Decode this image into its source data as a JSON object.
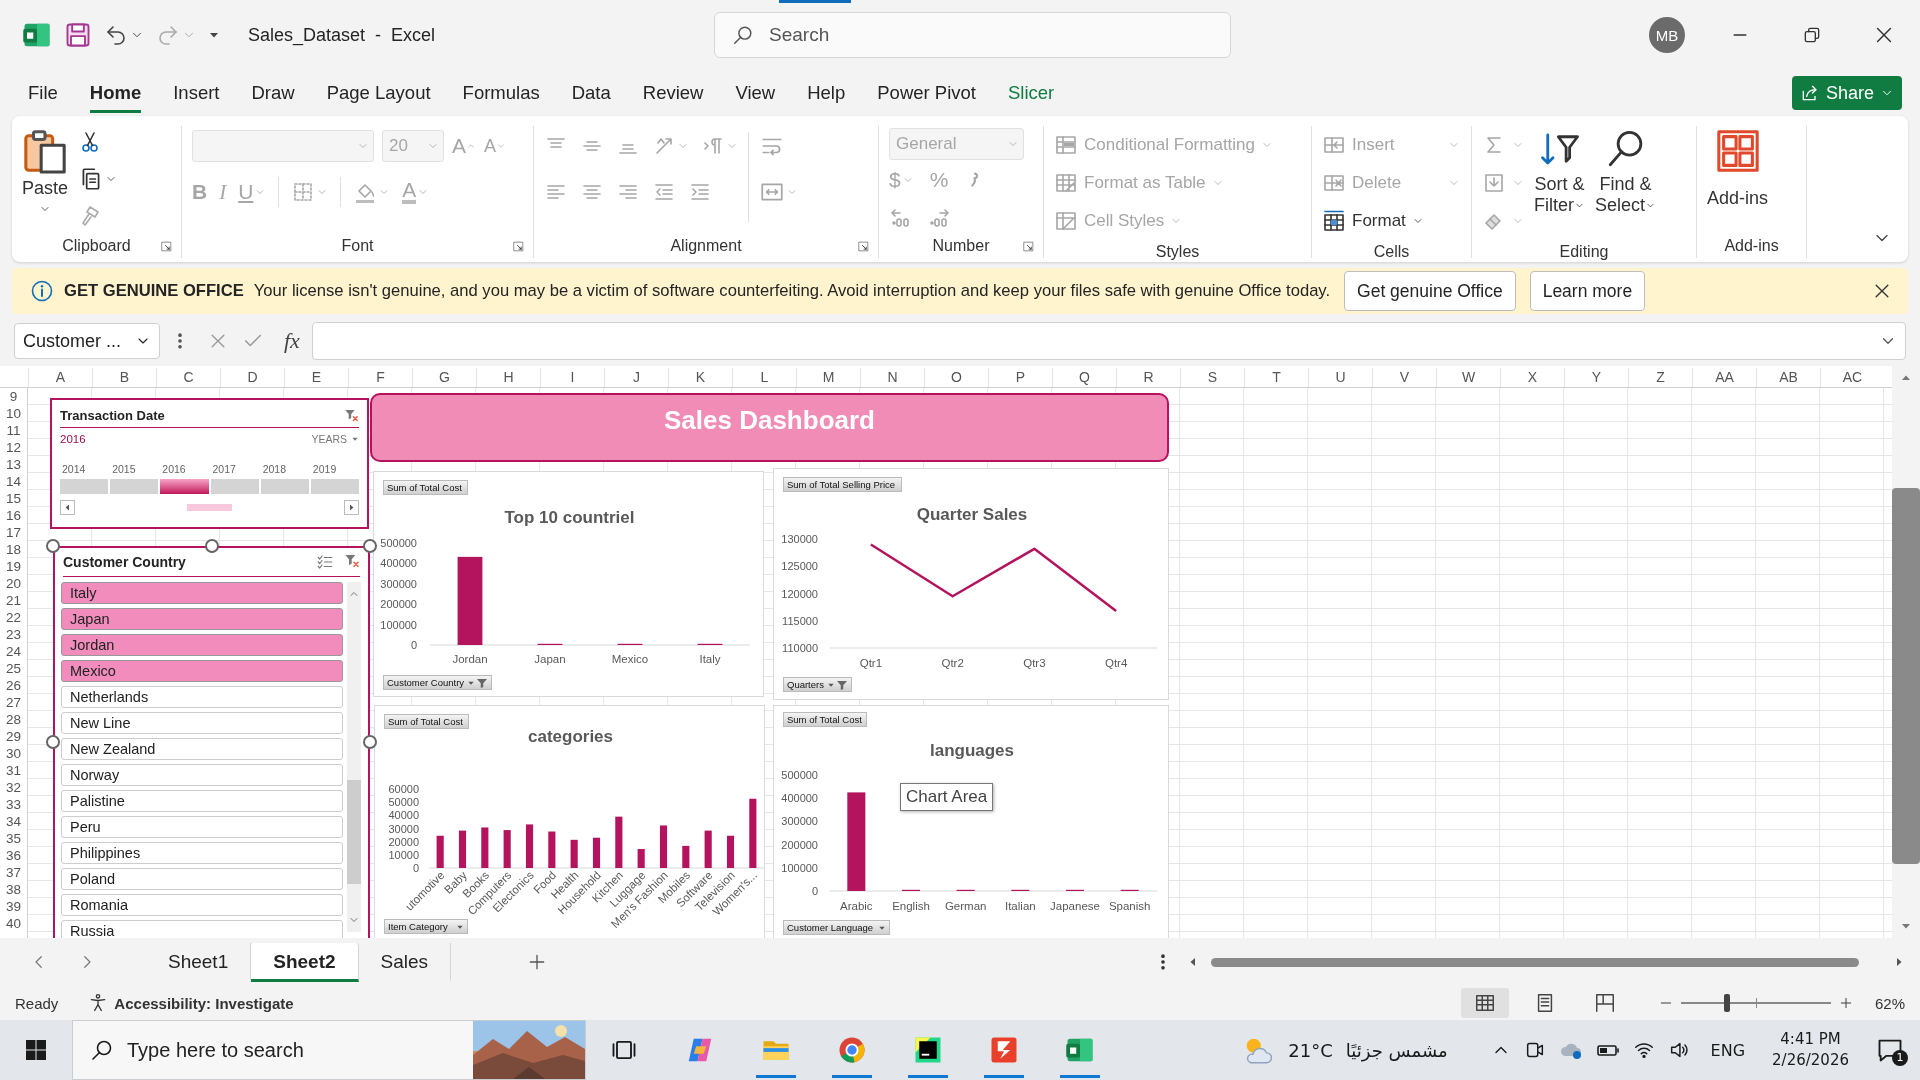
{
  "title_bar": {
    "title": "Sales_Dataset  -  Excel",
    "search": {
      "placeholder": "Search"
    },
    "avatar": "MB"
  },
  "menu_tabs": [
    {
      "label": "File",
      "selected": false,
      "kind": "normal"
    },
    {
      "label": "Home",
      "selected": true,
      "kind": "normal"
    },
    {
      "label": "Insert",
      "selected": false,
      "kind": "normal"
    },
    {
      "label": "Draw",
      "selected": false,
      "kind": "normal"
    },
    {
      "label": "Page Layout",
      "selected": false,
      "kind": "normal"
    },
    {
      "label": "Formulas",
      "selected": false,
      "kind": "normal"
    },
    {
      "label": "Data",
      "selected": false,
      "kind": "normal"
    },
    {
      "label": "Review",
      "selected": false,
      "kind": "normal"
    },
    {
      "label": "View",
      "selected": false,
      "kind": "normal"
    },
    {
      "label": "Help",
      "selected": false,
      "kind": "normal"
    },
    {
      "label": "Power Pivot",
      "selected": false,
      "kind": "normal"
    },
    {
      "label": "Slicer",
      "selected": false,
      "kind": "contextual"
    }
  ],
  "share_button": "Share",
  "ribbon": {
    "clipboard": {
      "paste": "Paste",
      "label": "Clipboard"
    },
    "font": {
      "disabled": true,
      "size": "20",
      "grow": "A",
      "shrink": "A",
      "bold": "B",
      "italic": "I",
      "underline": "U",
      "font_color": "A",
      "label": "Font"
    },
    "alignment": {
      "disabled": true,
      "label": "Alignment"
    },
    "number": {
      "disabled": true,
      "format": "General",
      "currency": "$",
      "percent": "%",
      "label": "Number"
    },
    "styles": {
      "label": "Styles",
      "items": [
        {
          "label": "Conditional Formatting",
          "disabled": true
        },
        {
          "label": "Format as Table",
          "disabled": true
        },
        {
          "label": "Cell Styles",
          "disabled": true
        }
      ]
    },
    "cells": {
      "label": "Cells",
      "items": [
        {
          "label": "Insert",
          "disabled": true
        },
        {
          "label": "Delete",
          "disabled": true
        },
        {
          "label": "Format",
          "disabled": false
        }
      ]
    },
    "editing": {
      "label": "Editing",
      "buttons": [
        {
          "kind": "sort",
          "lines": [
            "Sort &",
            "Filter"
          ]
        },
        {
          "kind": "find",
          "lines": [
            "Find &",
            "Select"
          ]
        }
      ]
    },
    "addins": {
      "label": "Add-ins",
      "button": "Add-ins"
    }
  },
  "license_bar": {
    "title": "GET GENUINE OFFICE",
    "message": "Your license isn't genuine, and you may be a victim of software counterfeiting. Avoid interruption and keep your files safe with genuine Office today.",
    "buttons": [
      "Get genuine Office",
      "Learn more"
    ]
  },
  "formula_bar": {
    "name_box": "Customer ...",
    "fx": "fx"
  },
  "sheet": {
    "columns": [
      "A",
      "B",
      "C",
      "D",
      "E",
      "F",
      "G",
      "H",
      "I",
      "J",
      "K",
      "L",
      "M",
      "N",
      "O",
      "P",
      "Q",
      "R",
      "S",
      "T",
      "U",
      "V",
      "W",
      "X",
      "Y",
      "Z",
      "AA",
      "AB",
      "AC"
    ],
    "rows": [
      "9",
      "10",
      "11",
      "12",
      "13",
      "14",
      "15",
      "16",
      "17",
      "18",
      "19",
      "20",
      "21",
      "22",
      "23",
      "24",
      "25",
      "26",
      "27",
      "28",
      "29",
      "30",
      "31",
      "32",
      "33",
      "34",
      "35",
      "36",
      "37",
      "38",
      "39",
      "40"
    ],
    "banner": "Sales Dashboard",
    "timeline": {
      "title": "Transaction Date",
      "selection": "2016",
      "period": "YEARS",
      "years": [
        {
          "label": "2014",
          "selected": false
        },
        {
          "label": "2015",
          "selected": false
        },
        {
          "label": "2016",
          "selected": true
        },
        {
          "label": "2017",
          "selected": false
        },
        {
          "label": "2018",
          "selected": false
        },
        {
          "label": "2019",
          "selected": false
        }
      ]
    },
    "country_slicer": {
      "title": "Customer Country",
      "items": [
        {
          "label": "Italy",
          "selected": true
        },
        {
          "label": "Japan",
          "selected": true
        },
        {
          "label": "Jordan",
          "selected": true
        },
        {
          "label": "Mexico",
          "selected": true
        },
        {
          "label": "Netherlands",
          "selected": false
        },
        {
          "label": "New Line",
          "selected": false
        },
        {
          "label": "New Zealand",
          "selected": false
        },
        {
          "label": "Norway",
          "selected": false
        },
        {
          "label": "Palistine",
          "selected": false
        },
        {
          "label": "Peru",
          "selected": false
        },
        {
          "label": "Philippines",
          "selected": false
        },
        {
          "label": "Poland",
          "selected": false
        },
        {
          "label": "Romania",
          "selected": false
        },
        {
          "label": "Russia",
          "selected": false
        }
      ]
    },
    "charts": [
      {
        "axis_field": "Customer Country",
        "axis_filtered": true,
        "chart_data": {
          "type": "bar",
          "title": "Top 10 countriel",
          "categories": [
            "Jordan",
            "Japan",
            "Mexico",
            "Italy"
          ],
          "series": [
            {
              "name": "Sum of Total Cost",
              "color": "#b4135e",
              "values": [
                432000,
                3000,
                3000,
                3000
              ]
            }
          ],
          "ylim": [
            0,
            500000
          ],
          "yticks": [
            0,
            100000,
            200000,
            300000,
            400000,
            500000
          ]
        }
      },
      {
        "axis_field": "Quarters",
        "axis_filtered": true,
        "chart_data": {
          "type": "line",
          "title": "Quarter Sales",
          "categories": [
            "Qtr1",
            "Qtr2",
            "Qtr3",
            "Qtr4"
          ],
          "series": [
            {
              "name": "Sum of Total Selling Price",
              "color": "#b4135e",
              "values": [
                129000,
                119500,
                128200,
                116800
              ]
            }
          ],
          "ylim": [
            110000,
            130000
          ],
          "yticks": [
            110000,
            115000,
            120000,
            125000,
            130000
          ]
        }
      },
      {
        "axis_field": "Item Category",
        "axis_filtered": false,
        "chart_data": {
          "type": "bar",
          "title": "categories",
          "categories": [
            "utomotive",
            "Baby",
            "Books",
            "Computers",
            "Electonics",
            "Food",
            "Health",
            "Household",
            "Kitchen",
            "Luggage",
            "Men's Fashion",
            "Mobiles",
            "Software",
            "Television",
            "Women's..."
          ],
          "series": [
            {
              "name": "Sum of Total Cost",
              "color": "#b4135e",
              "values": [
                24500,
                28400,
                30800,
                28800,
                33100,
                27700,
                21400,
                23000,
                39000,
                14400,
                32300,
                16800,
                28400,
                24500,
                52600
              ]
            }
          ],
          "ylim": [
            0,
            60000
          ],
          "yticks": [
            0,
            10000,
            20000,
            30000,
            40000,
            50000,
            60000
          ]
        }
      },
      {
        "axis_field": "Customer Language",
        "axis_filtered": false,
        "tooltip": "Chart Area",
        "chart_data": {
          "type": "bar",
          "title": "languages",
          "categories": [
            "Arabic",
            "English",
            "German",
            "Italian",
            "Japanese",
            "Spanish"
          ],
          "series": [
            {
              "name": "Sum of Total Cost",
              "color": "#b4135e",
              "values": [
                425000,
                3000,
                3000,
                3000,
                3000,
                3000
              ]
            }
          ],
          "ylim": [
            0,
            500000
          ],
          "yticks": [
            0,
            100000,
            200000,
            300000,
            400000,
            500000
          ]
        }
      }
    ]
  },
  "sheet_tabs": [
    {
      "label": "Sheet1",
      "selected": false
    },
    {
      "label": "Sheet2",
      "selected": true
    },
    {
      "label": "Sales",
      "selected": false
    }
  ],
  "status_bar": {
    "mode": "Ready",
    "accessibility": "Accessibility: Investigate",
    "views": [
      {
        "kind": "normal",
        "selected": true
      },
      {
        "kind": "page_layout",
        "selected": false
      },
      {
        "kind": "page_break",
        "selected": false
      }
    ],
    "zoom_slider": {
      "level": 0.31
    },
    "zoom": "62%"
  },
  "taskbar": {
    "search": {
      "placeholder": "Type here to search"
    },
    "apps": [
      {
        "kind": "task_view",
        "running": false
      },
      {
        "kind": "copilot",
        "running": false
      },
      {
        "kind": "explorer",
        "running": true
      },
      {
        "kind": "chrome",
        "running": true
      },
      {
        "kind": "pycharm",
        "running": true
      },
      {
        "kind": "reader",
        "running": true
      },
      {
        "kind": "excel",
        "running": true
      }
    ],
    "temperature": "21°C",
    "weather": "مشمس جزئيًا",
    "language": "ENG",
    "time": "4:41 PM",
    "date": "2/26/2026",
    "notifications": "1"
  }
}
